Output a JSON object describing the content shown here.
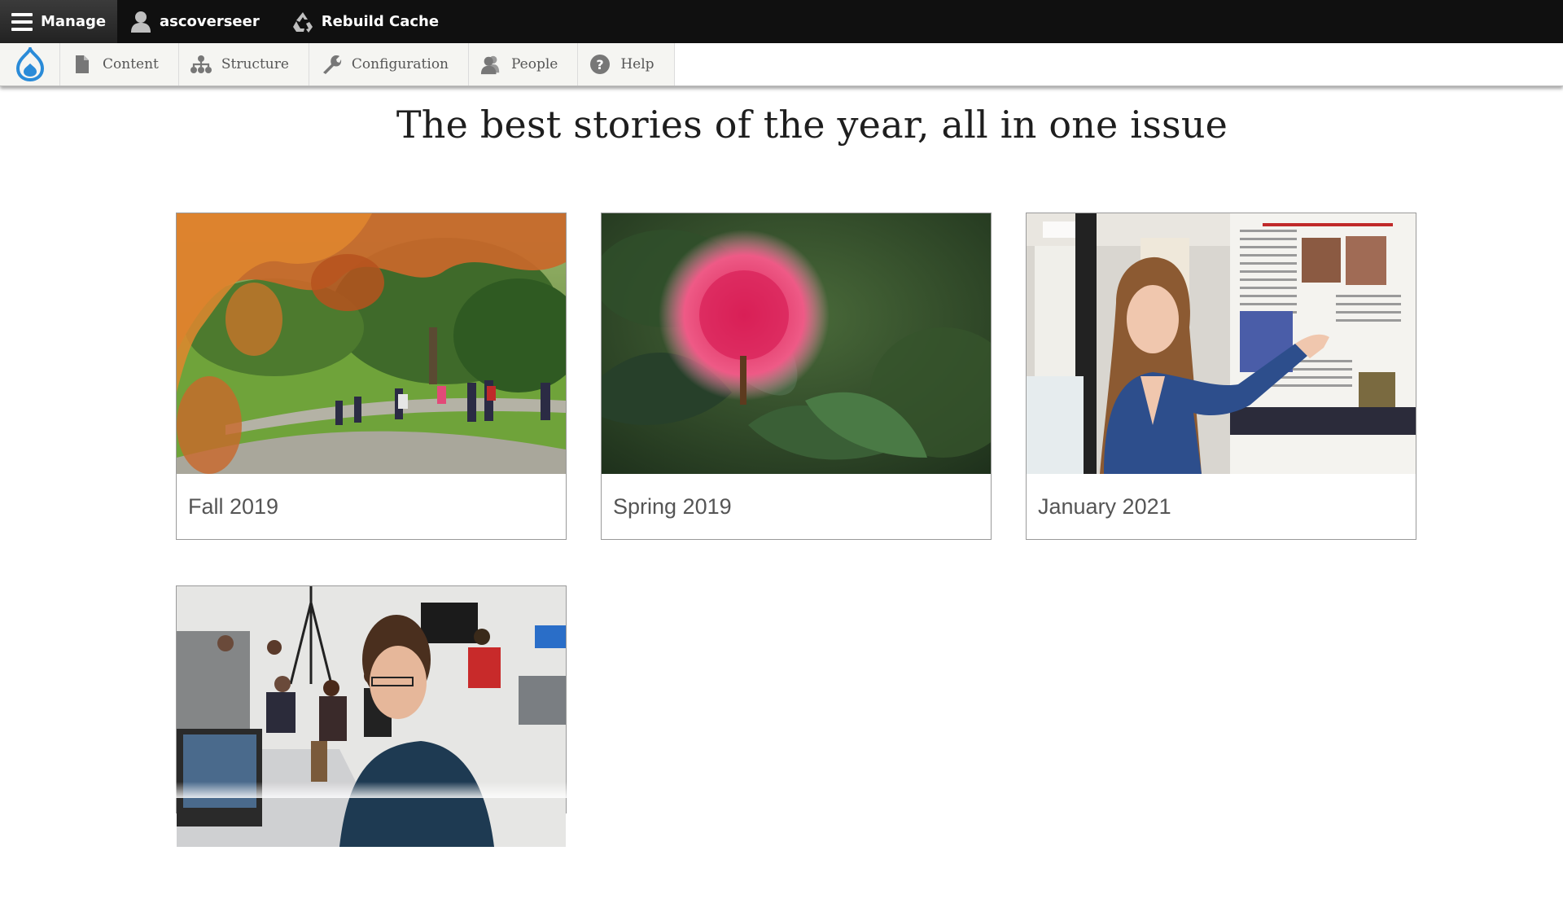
{
  "toolbar": {
    "manage_label": "Manage",
    "user_label": "ascoverseer",
    "cache_label": "Rebuild Cache"
  },
  "tray": {
    "items": [
      {
        "label": "Content",
        "icon": "file-icon"
      },
      {
        "label": "Structure",
        "icon": "sitemap-icon"
      },
      {
        "label": "Configuration",
        "icon": "wrench-icon"
      },
      {
        "label": "People",
        "icon": "people-icon"
      },
      {
        "label": "Help",
        "icon": "help-icon"
      }
    ]
  },
  "page": {
    "title": "The best stories of the year, all in one issue"
  },
  "issues": [
    {
      "caption": "Fall 2019"
    },
    {
      "caption": "Spring 2019"
    },
    {
      "caption": "January 2021"
    },
    {
      "caption": ""
    }
  ],
  "colors": {
    "toolbar_bg": "#101010",
    "drupal_blue": "#2a8bd8",
    "caption_text": "#555555"
  }
}
